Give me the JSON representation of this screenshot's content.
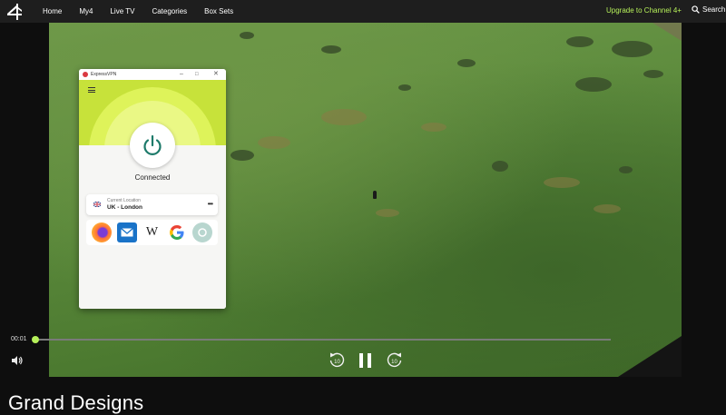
{
  "header": {
    "logo": "channel-4-logo",
    "nav": [
      "Home",
      "My4",
      "Live TV",
      "Categories",
      "Box Sets"
    ],
    "upgrade_label": "Upgrade to Channel 4+",
    "search_label": "Search"
  },
  "vpn": {
    "app_title": "ExpressVPN",
    "window_controls": [
      "–",
      "□",
      "✕"
    ],
    "status": "Connected",
    "location_label": "Current Location",
    "location_value": "UK - London",
    "more_label": "•••",
    "shortcuts": [
      "firefox-icon",
      "mail-icon",
      "wikipedia-icon",
      "google-icon",
      "expressvpn-shortcut-icon"
    ],
    "wiki_glyph": "W"
  },
  "player": {
    "current_time": "00:01",
    "progress_fraction": 0.002,
    "skip_back_label": "10",
    "skip_forward_label": "10",
    "state": "playing"
  },
  "show": {
    "title": "Grand Designs"
  },
  "colors": {
    "accent": "#b6f05a",
    "vpn_brand": "#da3940",
    "vpn_hero": "#c7e23a",
    "power_icon": "#1d7a6a"
  }
}
